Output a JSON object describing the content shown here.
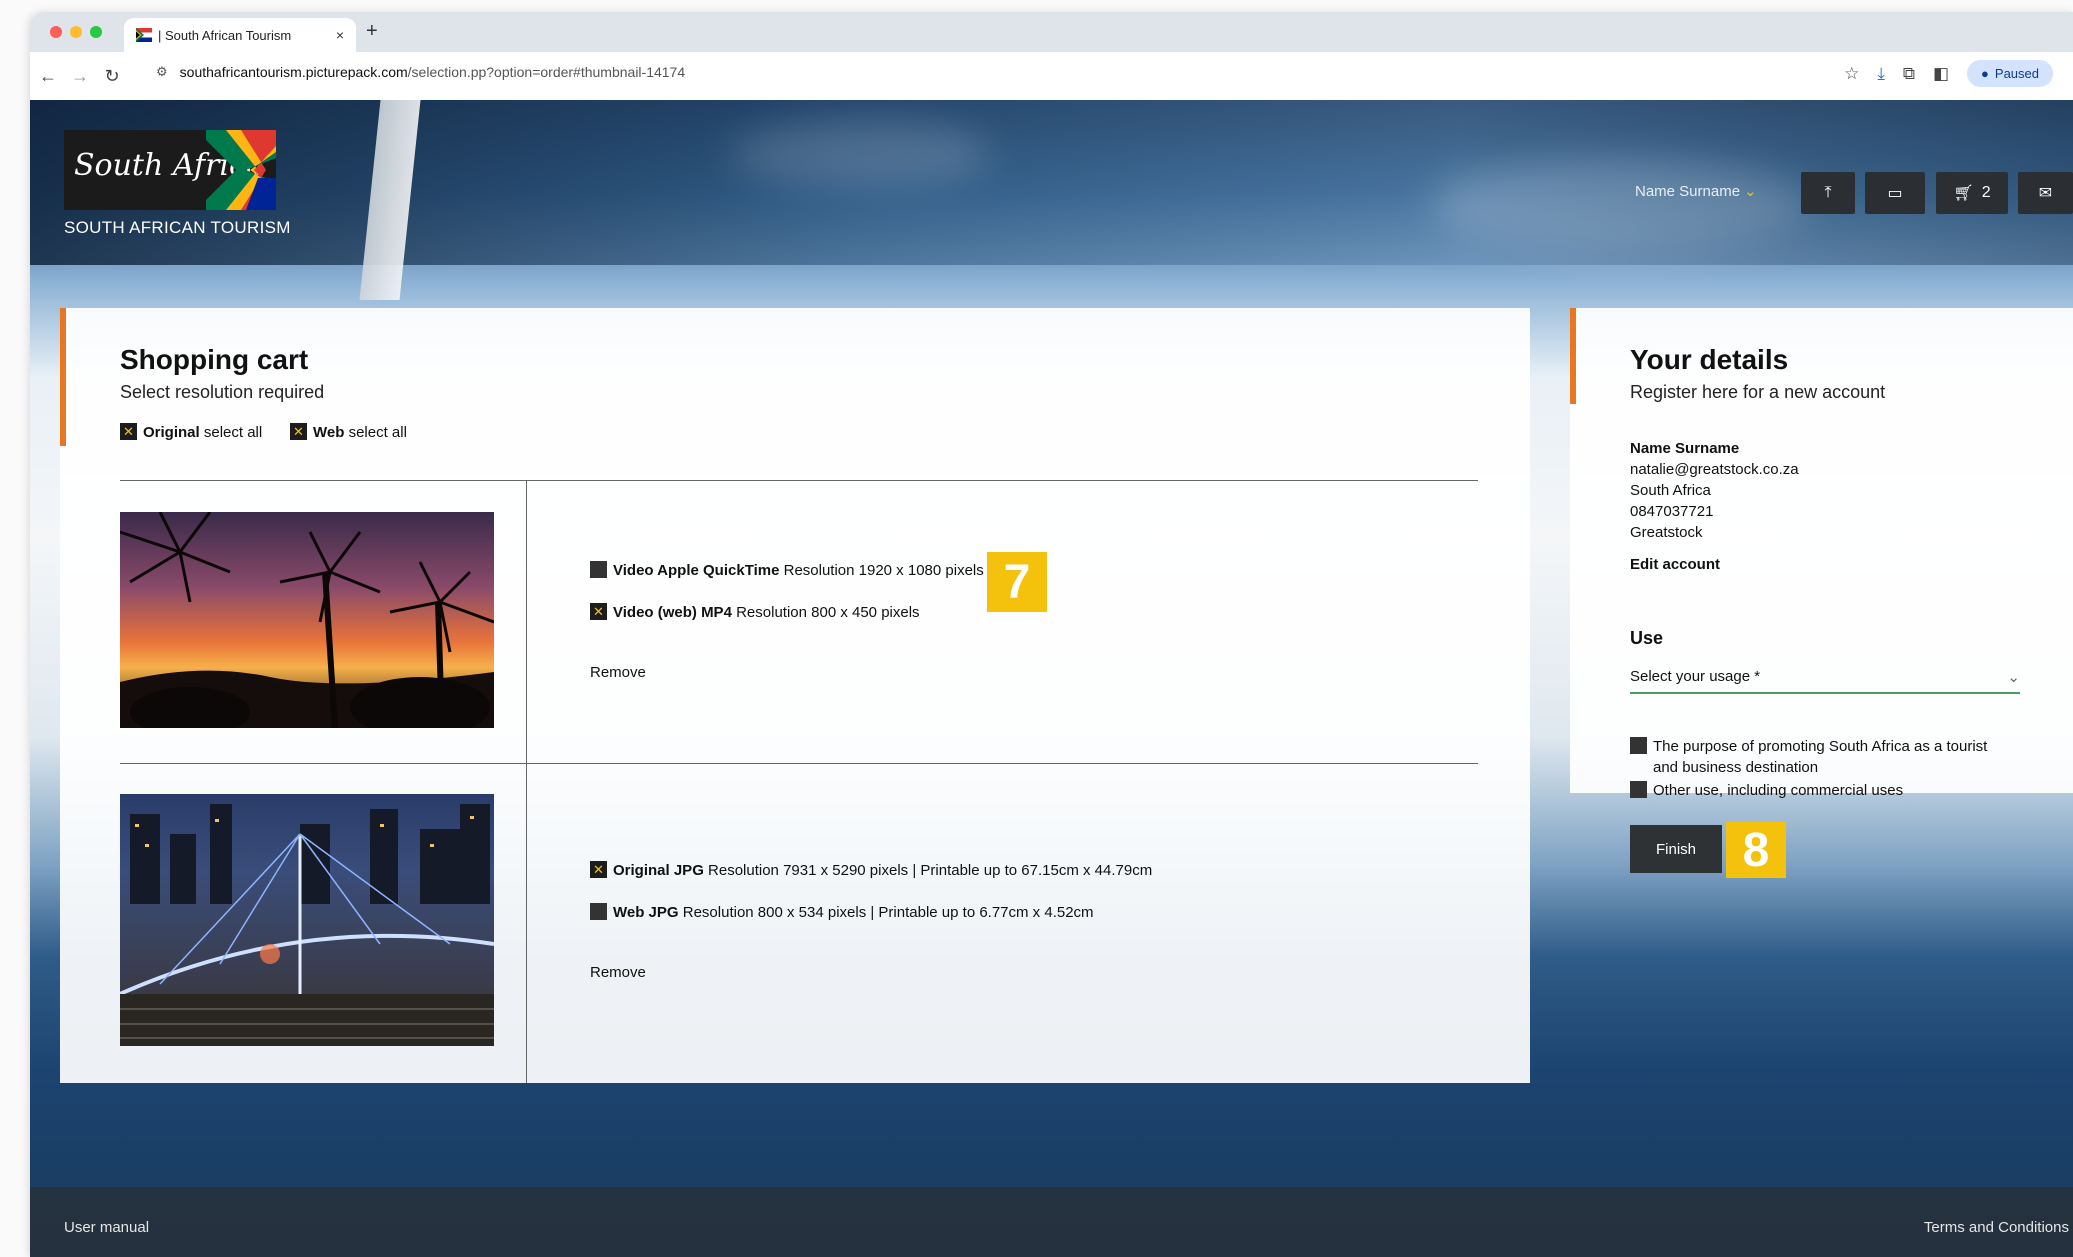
{
  "browser": {
    "tab_title": "| South African Tourism",
    "tab_close": "×",
    "new_tab": "+",
    "url_host": "southafricantourism.picturepack.com",
    "url_path": "/selection.pp?option=order#thumbnail-14174",
    "profile_label": "Paused"
  },
  "header": {
    "logo_script": "South Africa",
    "logo_subtitle": "SOUTH AFRICAN TOURISM",
    "user_name": "Name Surname",
    "cart_count": "2"
  },
  "cart": {
    "title": "Shopping cart",
    "subtitle": "Select resolution required",
    "select_all": [
      {
        "bold": "Original",
        "rest": " select all",
        "checked": true
      },
      {
        "bold": "Web",
        "rest": " select all",
        "checked": true
      }
    ],
    "items": [
      {
        "options": [
          {
            "name": "Video Apple QuickTime",
            "rest": " Resolution  1920 x 1080 pixels",
            "checked": false
          },
          {
            "name": "Video (web) MP4",
            "rest": " Resolution  800 x 450 pixels",
            "checked": true
          }
        ],
        "remove": "Remove"
      },
      {
        "options": [
          {
            "name": "Original JPG",
            "rest": " Resolution  7931 x 5290 pixels  | Printable up to 67.15cm x 44.79cm",
            "checked": true
          },
          {
            "name": "Web JPG",
            "rest": " Resolution  800 x 534 pixels  | Printable up to 6.77cm x 4.52cm",
            "checked": false
          }
        ],
        "remove": "Remove"
      }
    ],
    "marker_label": "7"
  },
  "details": {
    "title": "Your details",
    "subtitle": "Register here for a new account",
    "name": "Name Surname",
    "email": "natalie@greatstock.co.za",
    "country": "South Africa",
    "phone": "0847037721",
    "company": "Greatstock",
    "edit_account": "Edit account",
    "use_label": "Use",
    "usage_placeholder": "Select your usage *",
    "usage_options": [
      {
        "label": "The purpose of promoting South Africa as a tourist",
        "label2": "and business destination",
        "checked": false
      },
      {
        "label": "Other use, including commercial uses",
        "checked": false
      }
    ],
    "finish_label": "Finish",
    "marker_label": "8"
  },
  "footer": {
    "user_manual": "User manual",
    "terms": "Terms and Conditions"
  },
  "colors": {
    "accent_orange": "#e87722",
    "marker_yellow": "#f4c20d",
    "button_dark": "#2f3235"
  }
}
